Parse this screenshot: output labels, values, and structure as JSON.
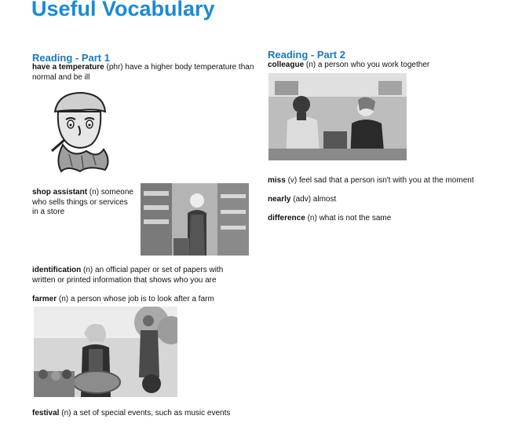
{
  "page_title": "Useful Vocabulary",
  "part1": {
    "heading": "Reading - Part 1",
    "entries": [
      {
        "word": "have a temperature",
        "def": " (phr) have a higher body temperature than normal and be ill"
      },
      {
        "word": "shop assistant",
        "def": " (n) someone who sells things or services in a store"
      },
      {
        "word": "identification",
        "def": " (n) an official paper or set of papers with written or printed information that shows who you are"
      },
      {
        "word": "farmer",
        "def": " (n) a person whose job is to look after a farm"
      },
      {
        "word": "festival",
        "def": " (n) a set of special events, such as music events"
      }
    ]
  },
  "part2": {
    "heading": "Reading - Part 2",
    "entries": [
      {
        "word": "colleague",
        "def": " (n) a person who you work together"
      },
      {
        "word": "miss",
        "def": " (v) feel sad that a person isn't with you at the moment"
      },
      {
        "word": "nearly",
        "def": " (adv) almost"
      },
      {
        "word": "difference",
        "def": " (n) what is not the same"
      }
    ]
  },
  "images": [
    "sick-man-cartoon",
    "shop-assistant-photo",
    "farmer-photo",
    "colleagues-photo"
  ]
}
